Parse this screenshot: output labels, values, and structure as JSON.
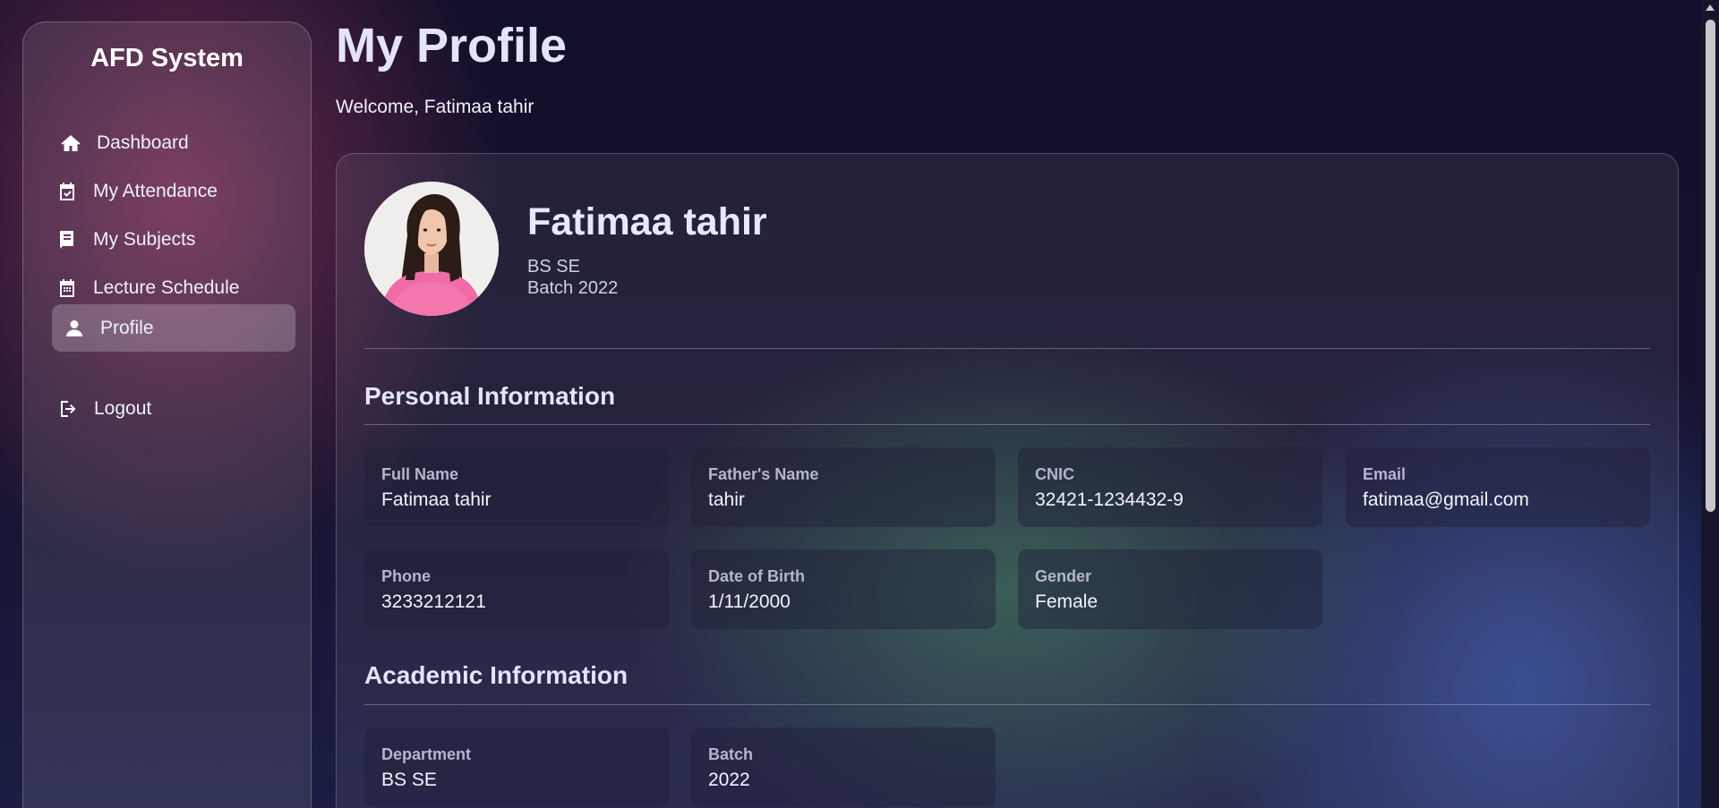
{
  "sidebar": {
    "brand": "AFD System",
    "items": [
      {
        "label": "Dashboard",
        "icon": "home-icon",
        "active": false
      },
      {
        "label": "My Attendance",
        "icon": "calendar-check-icon",
        "active": false
      },
      {
        "label": "My Subjects",
        "icon": "book-icon",
        "active": false
      },
      {
        "label": "Lecture Schedule",
        "icon": "calendar-icon",
        "active": false
      },
      {
        "label": "Profile",
        "icon": "user-icon",
        "active": true
      }
    ],
    "logout": {
      "label": "Logout",
      "icon": "logout-icon"
    }
  },
  "header": {
    "title": "My Profile",
    "welcome": "Welcome, Fatimaa tahir"
  },
  "profile": {
    "name": "Fatimaa tahir",
    "program": "BS SE",
    "batch": "Batch 2022",
    "avatar": "profile-photo"
  },
  "personal": {
    "title": "Personal Information",
    "fields": [
      {
        "label": "Full Name",
        "value": "Fatimaa tahir"
      },
      {
        "label": "Father's Name",
        "value": "tahir"
      },
      {
        "label": "CNIC",
        "value": "32421-1234432-9"
      },
      {
        "label": "Email",
        "value": "fatimaa@gmail.com"
      },
      {
        "label": "Phone",
        "value": "3233212121"
      },
      {
        "label": "Date of Birth",
        "value": "1/11/2000"
      },
      {
        "label": "Gender",
        "value": "Female"
      }
    ]
  },
  "academic": {
    "title": "Academic Information",
    "fields": [
      {
        "label": "Department",
        "value": "BS SE"
      },
      {
        "label": "Batch",
        "value": "2022"
      }
    ]
  },
  "colors": {
    "accent_text": "#e3e4fb",
    "active_nav_bg": "rgba(255,255,255,0.22)"
  }
}
